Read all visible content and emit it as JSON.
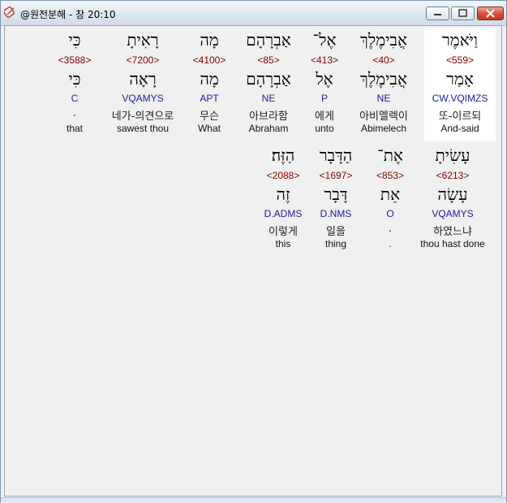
{
  "window": {
    "title": "@원전분해 - 창 20:10"
  },
  "rows": [
    [
      {
        "heb": "וַיֹּאמֶר",
        "strong": "<559>",
        "lemma": "אָמַר",
        "morph": "CW.VQIMZS",
        "kor": "또-이르되",
        "eng": "And-said"
      },
      {
        "heb": "אֲבִימֶלֶךְ",
        "strong": "<40>",
        "lemma": "אֲבִימֶלֶךְ",
        "morph": "NE",
        "kor": "아비멜렉이",
        "eng": "Abimelech"
      },
      {
        "heb": "אֶל־",
        "strong": "<413>",
        "lemma": "אֶל",
        "morph": "P",
        "kor": "에게",
        "eng": "unto"
      },
      {
        "heb": "אַבְרָהָם",
        "strong": "<85>",
        "lemma": "אַבְרָהָם",
        "morph": "NE",
        "kor": "아브라함",
        "eng": "Abraham"
      },
      {
        "heb": "מָה",
        "strong": "<4100>",
        "lemma": "מָה",
        "morph": "APT",
        "kor": "무슨",
        "eng": "What"
      },
      {
        "heb": "רָאִיתָ",
        "strong": "<7200>",
        "lemma": "רָאָה",
        "morph": "VQAMYS",
        "kor": "네가-의견으로",
        "eng": "sawest thou"
      },
      {
        "heb": "כִּי",
        "strong": "<3588>",
        "lemma": "כִּי",
        "morph": "C",
        "kor": ".",
        "eng": "that"
      }
    ],
    [
      {
        "heb": "עָשִׂיתָ",
        "strong": "<6213>",
        "lemma": "עָשָׂה",
        "morph": "VQAMYS",
        "kor": "하였느냐",
        "eng": "thou hast done"
      },
      {
        "heb": "אֶת־",
        "strong": "<853>",
        "lemma": "אֵת",
        "morph": "O",
        "kor": ".",
        "eng": "."
      },
      {
        "heb": "הַדָּבָר",
        "strong": "<1697>",
        "lemma": "דָּבָר",
        "morph": "D.NMS",
        "kor": "일을",
        "eng": "thing"
      },
      {
        "heb": "הַזֶּה׃",
        "strong": "<2088>",
        "lemma": "זֶה",
        "morph": "D.ADMS",
        "kor": "이렇게",
        "eng": "this"
      }
    ]
  ],
  "colors": {
    "strong": "#8b0000",
    "morph": "#1a1aa8",
    "highlight": "#ffffff"
  }
}
